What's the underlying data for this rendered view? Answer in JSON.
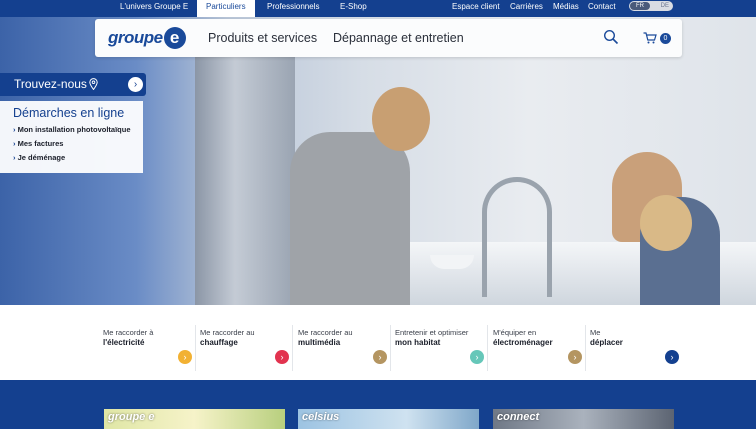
{
  "topbar": {
    "tabs": [
      {
        "label": "L'univers Groupe E",
        "active": false
      },
      {
        "label": "Particuliers",
        "active": true
      },
      {
        "label": "Professionnels",
        "active": false
      },
      {
        "label": "E-Shop",
        "active": false
      }
    ],
    "links": [
      "Espace client",
      "Carrières",
      "Médias",
      "Contact"
    ],
    "languages": {
      "selected": "FR",
      "other": "DE"
    }
  },
  "header": {
    "logo_text": "groupe",
    "logo_mark": "e",
    "nav": [
      "Produits et services",
      "Dépannage et entretien"
    ],
    "cart_count": "0"
  },
  "find_us": {
    "label": "Trouvez-nous"
  },
  "demarches": {
    "title": "Démarches en ligne",
    "items": [
      "Mon installation photovoltaïque",
      "Mes factures",
      "Je déménage"
    ]
  },
  "services": [
    {
      "line1": "Me raccorder à",
      "line2": "l'électricité",
      "color": "#f2b133"
    },
    {
      "line1": "Me raccorder au",
      "line2": "chauffage",
      "color": "#e2334f"
    },
    {
      "line1": "Me raccorder au",
      "line2": "multimédia",
      "color": "#b49561"
    },
    {
      "line1": "Entretenir et optimiser",
      "line2": "mon habitat",
      "color": "#66c7b9"
    },
    {
      "line1": "M'équiper en",
      "line2": "électroménager",
      "color": "#b49561"
    },
    {
      "line1": "Me",
      "line2": "déplacer",
      "color": "#14408f"
    }
  ],
  "promo_cards": [
    {
      "caption": "groupe e",
      "bg": "#c8d48a"
    },
    {
      "caption": "celsius",
      "bg": "#8fb8d9"
    },
    {
      "caption": "connect",
      "bg": "#7c8594"
    }
  ],
  "colors": {
    "brand": "#14408f"
  }
}
